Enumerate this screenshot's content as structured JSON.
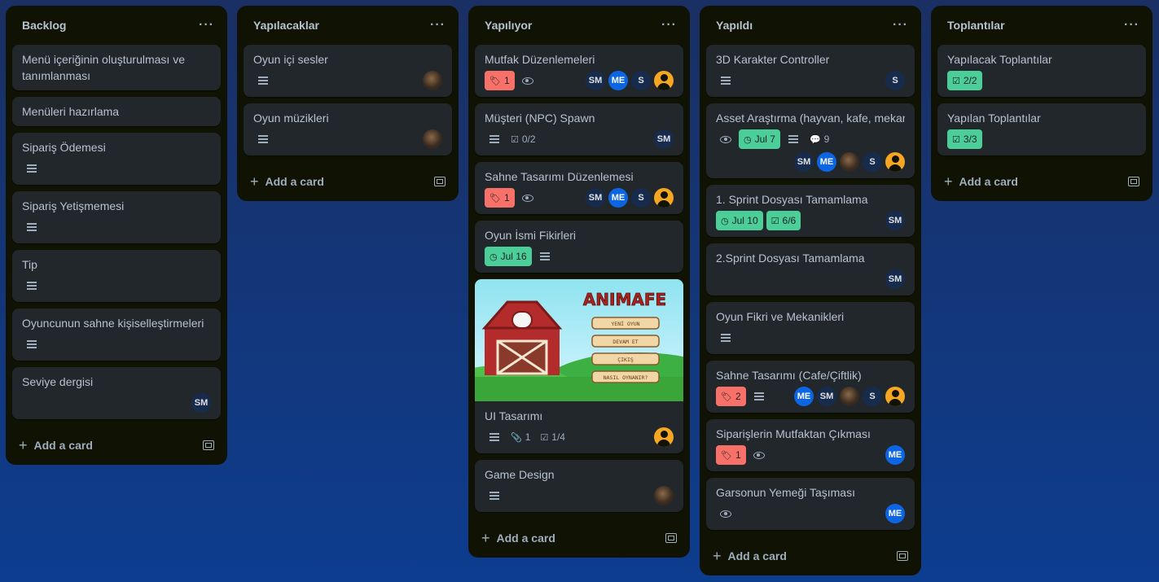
{
  "board": {
    "lists": [
      {
        "title": "Backlog",
        "add_label": "Add a card",
        "cards": [
          {
            "title": "Menü içeriğinin oluşturulması ve tanımlanması"
          },
          {
            "title": "Menüleri hazırlama"
          },
          {
            "title": "Sipariş Ödemesi"
          },
          {
            "title": "Sipariş Yetişmemesi"
          },
          {
            "title": "Tip"
          },
          {
            "title": "Oyuncunun sahne kişiselleştirmeleri"
          },
          {
            "title": "Seviye dergisi",
            "member_sm": "SM"
          }
        ]
      },
      {
        "title": "Yapılacaklar",
        "add_label": "Add a card",
        "cards": [
          {
            "title": "Oyun içi sesler"
          },
          {
            "title": "Oyun müzikleri"
          }
        ]
      },
      {
        "title": "Yapılıyor",
        "add_label": "Add a card",
        "cards": [
          {
            "title": "Mutfak Düzenlemeleri",
            "label_count": "1",
            "members": [
              "SM",
              "ME",
              "S"
            ]
          },
          {
            "title": "Müşteri (NPC) Spawn",
            "checklist": "0/2",
            "members": [
              "SM"
            ]
          },
          {
            "title": "Sahne Tasarımı Düzenlemesi",
            "label_count": "1",
            "members": [
              "SM",
              "ME",
              "S"
            ]
          },
          {
            "title": "Oyun İsmi Fikirleri",
            "due": "Jul 16"
          },
          {
            "title": "UI Tasarımı",
            "attachments": "1",
            "checklist": "1/4",
            "cover": {
              "logo": "ANIMAFE",
              "menu": [
                "YENİ OYUN",
                "DEVAM ET",
                "ÇIKIŞ",
                "NASIL OYNANIR?"
              ]
            }
          },
          {
            "title": "Game Design"
          }
        ]
      },
      {
        "title": "Yapıldı",
        "add_label": "Add a card",
        "cards": [
          {
            "title": "3D Karakter Controller",
            "members": [
              "S"
            ]
          },
          {
            "title": "Asset Araştırma (hayvan, kafe, mekan",
            "due": "Jul 7",
            "comments": "9",
            "members": [
              "SM",
              "ME",
              "S"
            ]
          },
          {
            "title": "1. Sprint Dosyası Tamamlama",
            "due": "Jul 10",
            "checklist": "6/6",
            "members": [
              "SM"
            ]
          },
          {
            "title": "2.Sprint Dosyası Tamamlama",
            "members": [
              "SM"
            ]
          },
          {
            "title": "Oyun Fikri ve Mekanikleri"
          },
          {
            "title": "Sahne Tasarımı (Cafe/Çiftlik)",
            "label_count": "2",
            "members": [
              "ME",
              "SM",
              "S"
            ]
          },
          {
            "title": "Siparişlerin Mutfaktan Çıkması",
            "label_count": "1",
            "members": [
              "ME"
            ]
          },
          {
            "title": "Garsonun Yemeği Taşıması",
            "members": [
              "ME"
            ]
          }
        ]
      },
      {
        "title": "Toplantılar",
        "add_label": "Add a card",
        "cards": [
          {
            "title": "Yapılacak Toplantılar",
            "checklist": "2/2"
          },
          {
            "title": "Yapılan Toplantılar",
            "checklist": "3/3"
          }
        ]
      }
    ]
  },
  "colors": {
    "list_bg": "#101204",
    "card_bg": "#22272b",
    "label_red": "#f87168",
    "complete_green": "#4bce97",
    "member_me": "#0c66e4",
    "member_default": "#172b4d",
    "avatar_orange": "#f5a623"
  },
  "icons": {
    "menu": "more-horizontal-icon",
    "description": "description-lines-icon",
    "watch": "eye-icon",
    "label": "tag-icon",
    "due": "clock-icon",
    "checklist": "checkbox-icon",
    "attachment": "paperclip-icon",
    "comment": "speech-bubble-icon",
    "add": "plus-icon",
    "template": "card-template-icon"
  }
}
